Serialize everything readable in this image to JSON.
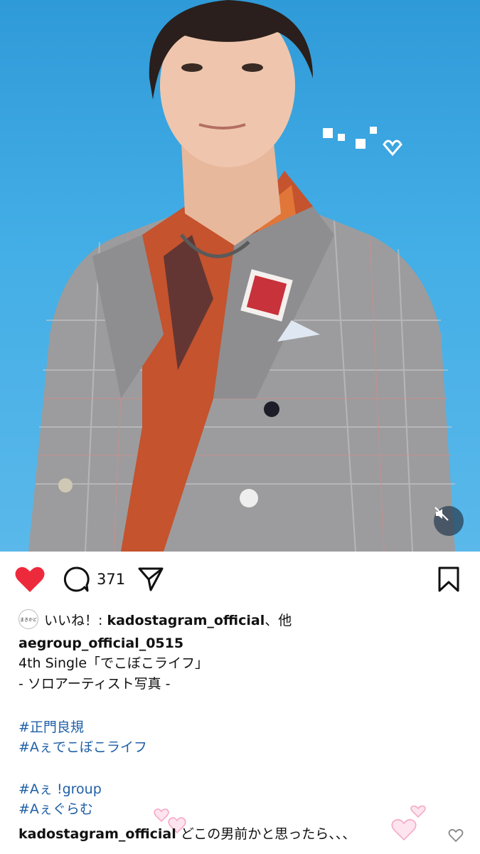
{
  "post": {
    "comment_count": "371",
    "liked_by_prefix": "いいね！: ",
    "liked_by_user": "kadostagram_official",
    "liked_by_suffix": "、他",
    "liked_avatar_text": "まきかど",
    "author": "aegroup_official_0515",
    "caption_lines": [
      "4th Single「でこぼこライフ」",
      "- ソロアーティスト写真 -"
    ],
    "hashtags_group1": [
      "#正門良規",
      "#Aぇでこぼこライフ"
    ],
    "hashtags_group2": [
      "#Aぇ !group",
      "#Aぇぐらむ"
    ]
  },
  "comment": {
    "user": "kadostagram_official",
    "text": "どこの男前かと思ったら、、、"
  },
  "colors": {
    "like_red": "#ed2a3c",
    "hashtag_blue": "#1f5fa6",
    "sky_blue": "#3aa6e2"
  },
  "icons": {
    "like": "heart-filled-icon",
    "comment": "speech-bubble-icon",
    "share": "paper-plane-icon",
    "save": "bookmark-icon",
    "mute": "speaker-muted-icon",
    "comment_like": "heart-outline-icon"
  }
}
